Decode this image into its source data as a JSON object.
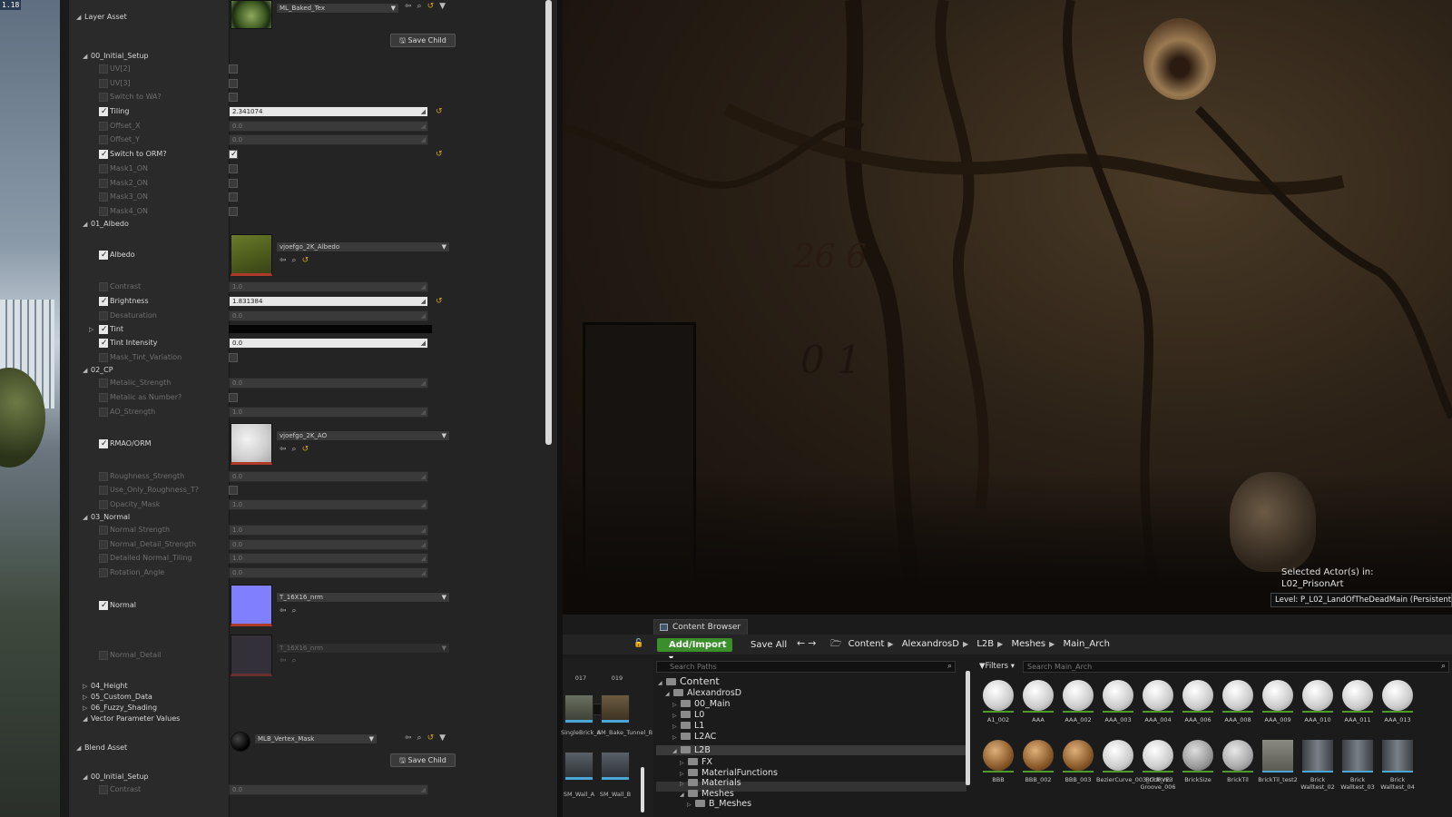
{
  "left_strip": {
    "corner_text": "1.18"
  },
  "details": {
    "layer_asset": {
      "header": "Layer Asset",
      "asset_name": "ML_Baked_Tex",
      "save_child": "Save Child"
    },
    "groups": {
      "initial_setup": "00_Initial_Setup",
      "albedo": "01_Albedo",
      "cp": "02_CP",
      "normal": "03_Normal",
      "height": "04_Height",
      "custom_data": "05_Custom_Data",
      "fuzzy_shading": "06_Fuzzy_Shading",
      "vector_params": "Vector Parameter Values"
    },
    "p": {
      "uv2": "UV[2]",
      "uv3": "UV[3]",
      "switch_wa": "Switch to WA?",
      "tiling": "Tiling",
      "tiling_val": "2.341074",
      "offset_x": "Offset_X",
      "offset_x_val": "0.0",
      "offset_y": "Offset_Y",
      "offset_y_val": "0.0",
      "switch_orm": "Switch to ORM?",
      "mask1": "Mask1_ON",
      "mask2": "Mask2_ON",
      "mask3": "Mask3_ON",
      "mask4": "Mask4_ON",
      "albedo": "Albedo",
      "albedo_tex": "vjoefgo_2K_Albedo",
      "contrast": "Contrast",
      "contrast_val": "1.0",
      "brightness": "Brightness",
      "brightness_val": "1.831384",
      "desaturation": "Desaturation",
      "desaturation_val": "0.0",
      "tint": "Tint",
      "tint_intensity": "Tint Intensity",
      "tint_intensity_val": "0.0",
      "mask_tint_var": "Mask_Tint_Variation",
      "metalic_strength": "Metalic_Strength",
      "metalic_strength_val": "0.0",
      "metalic_number": "Metalic as Number?",
      "ao_strength": "AO_Strength",
      "ao_strength_val": "1.0",
      "rmao": "RMAO/ORM",
      "rmao_tex": "vjoefgo_2K_AO",
      "roughness_strength": "Roughness_Strength",
      "roughness_strength_val": "0.0",
      "use_only_roughness": "Use_Only_Roughness_T?",
      "opacity_mask": "Opacity_Mask",
      "opacity_mask_val": "1.0",
      "normal_strength": "Normal Strength",
      "normal_strength_val": "1.0",
      "normal_detail_strength": "Normal_Detail_Strength",
      "normal_detail_strength_val": "0.0",
      "detailed_normal_tiling": "Detailed Normal_Tiling",
      "detailed_normal_tiling_val": "1.0",
      "rotation_angle": "Rotation_Angle",
      "rotation_angle_val": "0.0",
      "normal": "Normal",
      "normal_tex": "T_16X16_nrm",
      "normal_detail": "Normal_Detail",
      "normal_detail_tex": "T_16X16_nrm"
    },
    "blend_asset": {
      "header": "Blend Asset",
      "asset_name": "MLB_Vertex_Mask",
      "save_child": "Save Child",
      "group": "00_Initial_Setup",
      "contrast": "Contrast",
      "contrast_val": "0.0"
    }
  },
  "viewport": {
    "graffiti_1": "26 6",
    "graffiti_2": "0 1",
    "selected_line1": "Selected Actor(s) in:",
    "selected_line2": "L02_PrisonArt",
    "level": "Level:  P_L02_LandOfTheDeadMain (Persistent)"
  },
  "content_browser": {
    "tab": "Content Browser 2",
    "add_import": "Add/Import",
    "save_all": "Save All",
    "breadcrumbs": [
      "Content",
      "AlexandrosD",
      "L2B",
      "Meshes",
      "Main_Arch"
    ],
    "search_paths_placeholder": "Search Paths",
    "search_assets_placeholder": "Search Main_Arch",
    "filters": "Filters",
    "left_col_labels": {
      "n017": "017",
      "n019": "019"
    },
    "left_assets": [
      "SingleBrick_A",
      "SM_Bake_Tunnel_B",
      "SM_Wall_A",
      "SM_Wall_B"
    ],
    "tree": [
      "Content",
      "AlexandrosD",
      "00_Main",
      "L0",
      "L1",
      "L2AC",
      "L2B",
      "FX",
      "MaterialFunctions",
      "Materials",
      "Meshes",
      "B_Meshes"
    ],
    "assets_row1": [
      "A1_002",
      "AAA",
      "AAA_002",
      "AAA_003",
      "AAA_004",
      "AAA_006",
      "AAA_008",
      "AAA_009",
      "AAA_010",
      "AAA_011",
      "AAA_013"
    ],
    "assets_row2": [
      "BBB",
      "BBB_002",
      "BBB_003",
      "BezierCurve_003_CURVE3",
      "Brick_no Groove_006",
      "BrickSize",
      "BrickTil",
      "BrickTil_test2",
      "Brick Walltest_02",
      "Brick Walltest_03",
      "Brick Walltest_04"
    ]
  }
}
